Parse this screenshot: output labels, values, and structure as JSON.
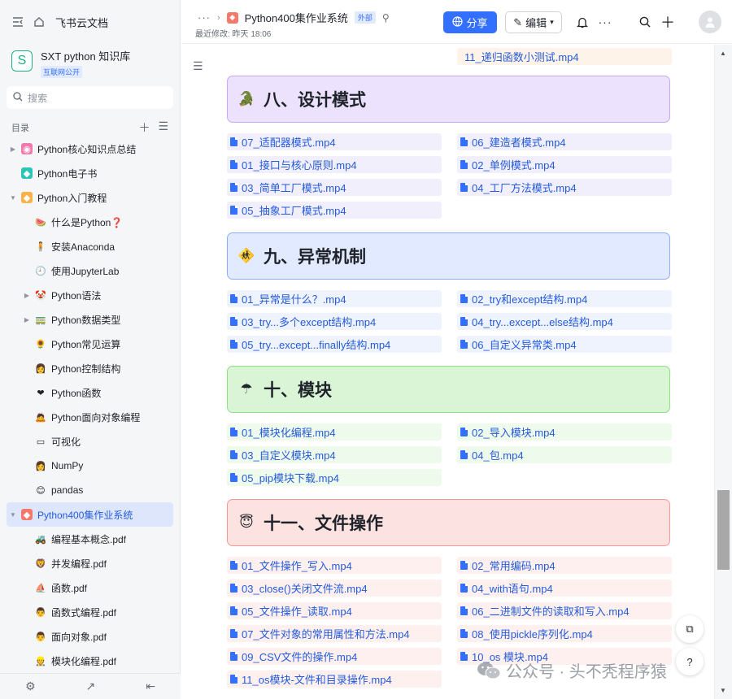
{
  "sidebar": {
    "home_label": "飞书云文档",
    "kb_logo": "S",
    "kb_title": "SXT python 知识库",
    "kb_badge": "互联网公开",
    "search_placeholder": "搜索",
    "toc_label": "目录",
    "tree": [
      {
        "label": "Python核心知识点总结",
        "level": 0,
        "arrow": "right",
        "icon_bg": "#f07ab0",
        "icon": "◉"
      },
      {
        "label": "Python电子书",
        "level": 0,
        "arrow": "none",
        "icon_bg": "#2bc4b6",
        "icon": "◆"
      },
      {
        "label": "Python入门教程",
        "level": 0,
        "arrow": "down",
        "icon_bg": "#f8b24a",
        "icon": "◆"
      },
      {
        "label": "什么是Python❓",
        "level": 1,
        "arrow": "none",
        "icon_bg": "transparent",
        "icon": "🍉"
      },
      {
        "label": "安装Anaconda",
        "level": 1,
        "arrow": "none",
        "icon_bg": "transparent",
        "icon": "🧍"
      },
      {
        "label": "使用JupyterLab",
        "level": 1,
        "arrow": "none",
        "icon_bg": "transparent",
        "icon": "🕘"
      },
      {
        "label": "Python语法",
        "level": 1,
        "arrow": "right",
        "icon_bg": "transparent",
        "icon": "🤡"
      },
      {
        "label": "Python数据类型",
        "level": 1,
        "arrow": "right",
        "icon_bg": "transparent",
        "icon": "🚃"
      },
      {
        "label": "Python常见运算",
        "level": 1,
        "arrow": "none",
        "icon_bg": "transparent",
        "icon": "🌻"
      },
      {
        "label": "Python控制结构",
        "level": 1,
        "arrow": "none",
        "icon_bg": "transparent",
        "icon": "👩"
      },
      {
        "label": "Python函数",
        "level": 1,
        "arrow": "none",
        "icon_bg": "transparent",
        "icon": "❤"
      },
      {
        "label": "Python面向对象编程",
        "level": 1,
        "arrow": "none",
        "icon_bg": "transparent",
        "icon": "🙇"
      },
      {
        "label": "可视化",
        "level": 1,
        "arrow": "none",
        "icon_bg": "transparent",
        "icon": "▭"
      },
      {
        "label": "NumPy",
        "level": 1,
        "arrow": "none",
        "icon_bg": "transparent",
        "icon": "👩"
      },
      {
        "label": "pandas",
        "level": 1,
        "arrow": "none",
        "icon_bg": "transparent",
        "icon": "😊"
      },
      {
        "label": "Python400集作业系统",
        "level": 0,
        "arrow": "down",
        "icon_bg": "#f5796a",
        "icon": "◆",
        "active": true
      },
      {
        "label": "编程基本概念.pdf",
        "level": 1,
        "arrow": "none",
        "icon_bg": "transparent",
        "icon": "🚜"
      },
      {
        "label": "并发编程.pdf",
        "level": 1,
        "arrow": "none",
        "icon_bg": "transparent",
        "icon": "🦁"
      },
      {
        "label": "函数.pdf",
        "level": 1,
        "arrow": "none",
        "icon_bg": "transparent",
        "icon": "⛵"
      },
      {
        "label": "函数式编程.pdf",
        "level": 1,
        "arrow": "none",
        "icon_bg": "transparent",
        "icon": "👨"
      },
      {
        "label": "面向对象.pdf",
        "level": 1,
        "arrow": "none",
        "icon_bg": "transparent",
        "icon": "👨"
      },
      {
        "label": "模块化编程.pdf",
        "level": 1,
        "arrow": "none",
        "icon_bg": "transparent",
        "icon": "👷"
      }
    ]
  },
  "header": {
    "breadcrumb_title": "Python400集作业系统",
    "external_badge": "外部",
    "last_modified": "最近修改: 昨天 18:06",
    "share_label": "分享",
    "edit_label": "编辑"
  },
  "main": {
    "top_file": "11_递归函数小测试.mp4",
    "sections": [
      {
        "title": "八、设计模式",
        "emoji": "🐊",
        "theme": "purple",
        "files": [
          "07_适配器模式.mp4",
          "06_建造者模式.mp4",
          "01_接口与核心原则.mp4",
          "02_单例模式.mp4",
          "03_简单工厂模式.mp4",
          "04_工厂方法模式.mp4",
          "05_抽象工厂模式.mp4"
        ]
      },
      {
        "title": "九、异常机制",
        "emoji": "🚸",
        "theme": "blue",
        "files": [
          "01_异常是什么？.mp4",
          "02_try和except结构.mp4",
          "03_try...多个except结构.mp4",
          "04_try...except...else结构.mp4",
          "05_try...except...finally结构.mp4",
          "06_自定义异常类.mp4"
        ]
      },
      {
        "title": "十、模块",
        "emoji": "☂",
        "theme": "green",
        "files": [
          "01_模块化编程.mp4",
          "02_导入模块.mp4",
          "03_自定义模块.mp4",
          "04_包.mp4",
          "05_pip模块下载.mp4"
        ]
      },
      {
        "title": "十一、文件操作",
        "emoji": "😇",
        "theme": "red",
        "files": [
          "01_文件操作_写入.mp4",
          "02_常用编码.mp4",
          "03_close()关闭文件流.mp4",
          "04_with语句.mp4",
          "05_文件操作_读取.mp4",
          "06_二进制文件的读取和写入.mp4",
          "07_文件对象的常用属性和方法.mp4",
          "08_使用pickle序列化.mp4",
          "09_CSV文件的操作.mp4",
          "10_os 模块.mp4",
          "11_os模块-文件和目录操作.mp4"
        ]
      }
    ]
  },
  "watermark": "公众号 · 头不秃程序猿"
}
